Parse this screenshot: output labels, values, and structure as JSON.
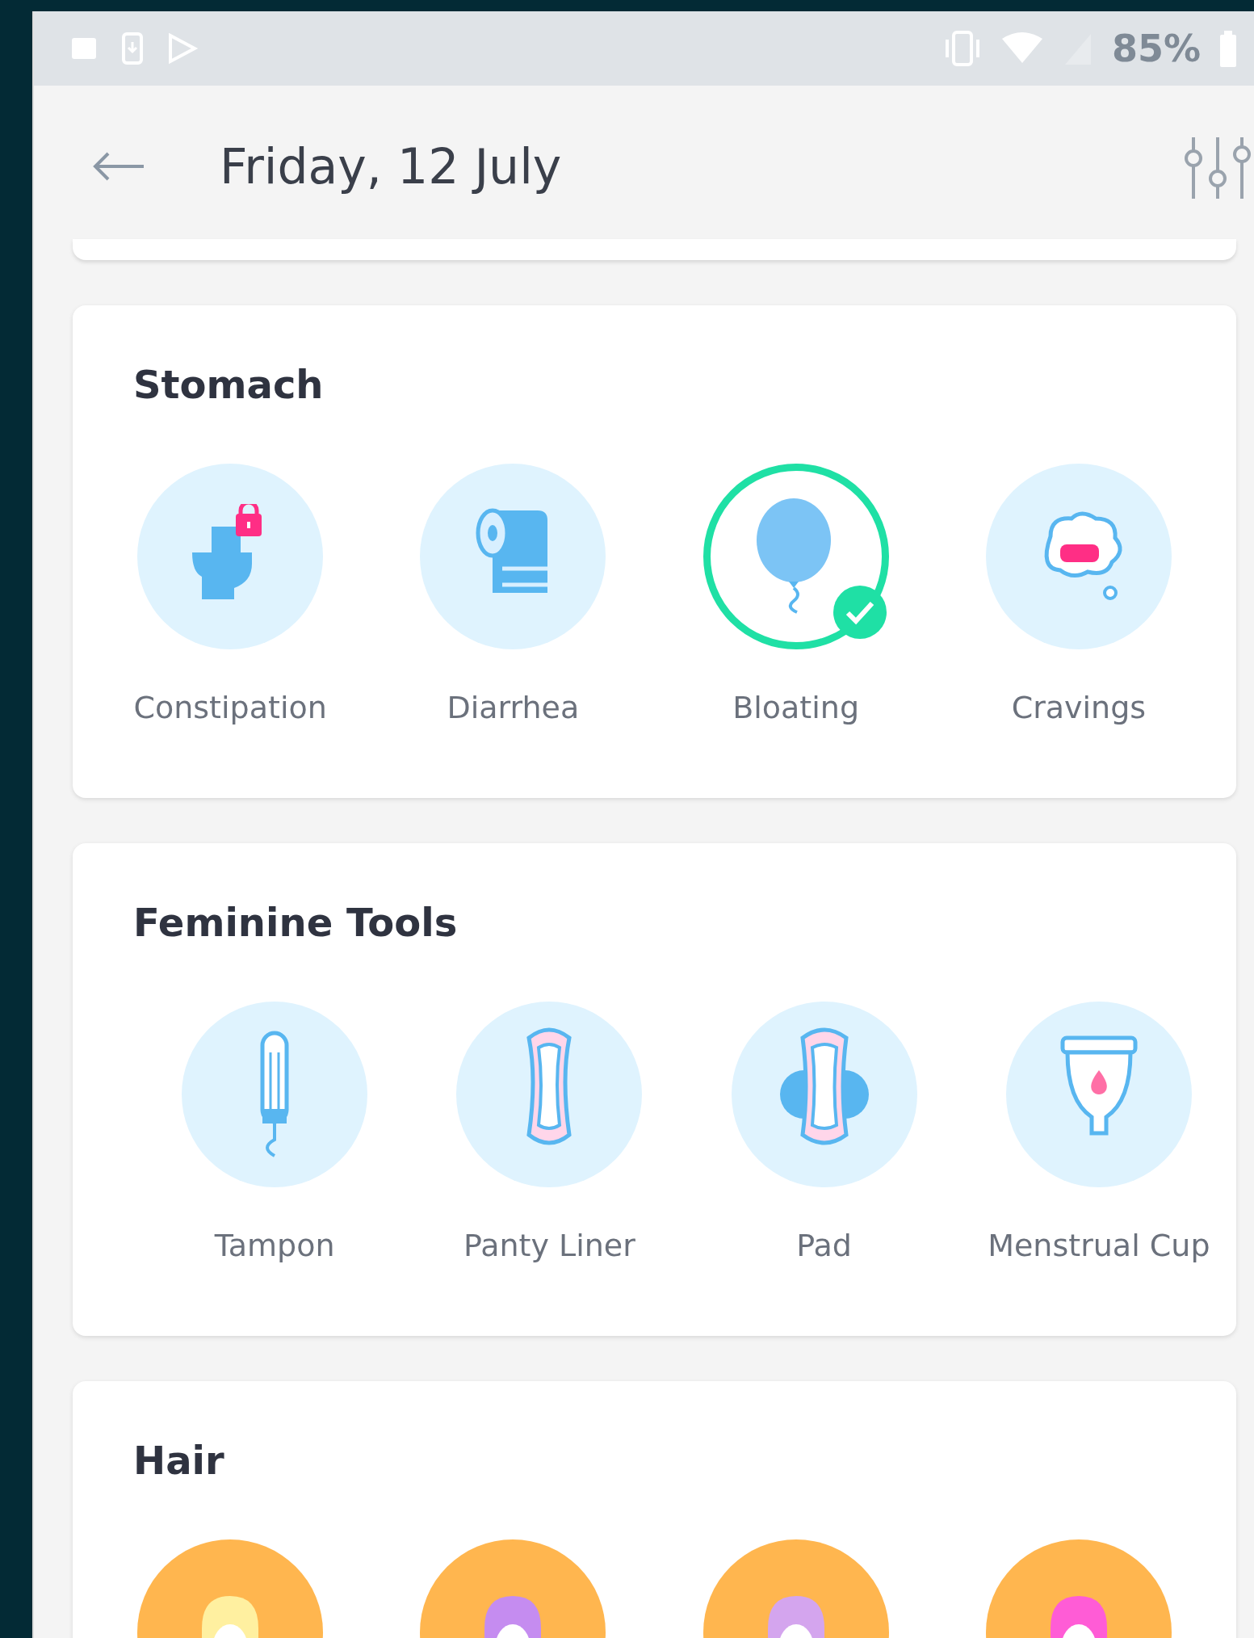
{
  "status_bar": {
    "battery": "85%"
  },
  "header": {
    "title": "Friday, 12 July"
  },
  "sections": [
    {
      "title": "Stomach",
      "kind": "symptoms",
      "items": [
        {
          "label": "Constipation",
          "kind": "toilet",
          "selected": false
        },
        {
          "label": "Diarrhea",
          "kind": "paper",
          "selected": false
        },
        {
          "label": "Bloating",
          "kind": "balloon",
          "selected": true
        },
        {
          "label": "Cravings",
          "kind": "craving",
          "selected": false
        }
      ]
    },
    {
      "title": "Feminine Tools",
      "kind": "symptoms",
      "items": [
        {
          "label": "Tampon",
          "kind": "tampon",
          "selected": false
        },
        {
          "label": "Panty Liner",
          "kind": "liner",
          "selected": false
        },
        {
          "label": "Pad",
          "kind": "pad",
          "selected": false
        },
        {
          "label": "Menstrual Cup",
          "kind": "cup",
          "selected": false
        }
      ]
    },
    {
      "title": "Hair",
      "kind": "hair",
      "items": [
        {
          "kind": "hair",
          "color": "#fff0a0",
          "selected": false
        },
        {
          "kind": "hair",
          "color": "#c58cf0",
          "selected": false
        },
        {
          "kind": "hair",
          "color": "#d4a5ee",
          "selected": false
        },
        {
          "kind": "hair",
          "color": "#ff5cd6",
          "selected": false
        }
      ]
    }
  ]
}
